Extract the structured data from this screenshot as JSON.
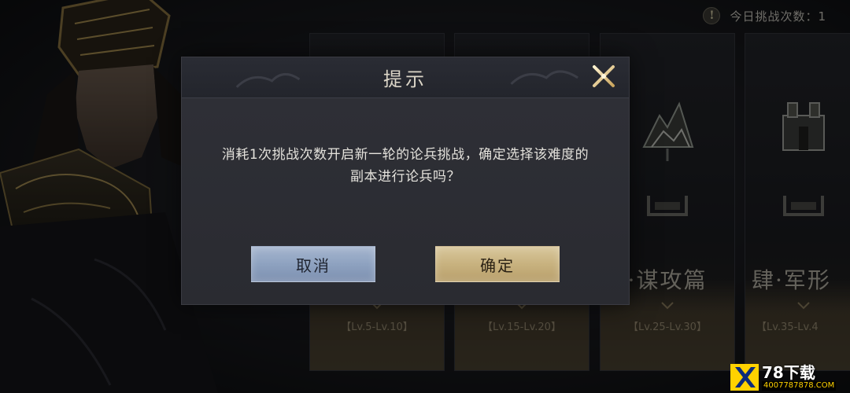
{
  "header": {
    "info_icon": "exclamation-icon",
    "challenge_count_label": "今日挑战次数：1"
  },
  "cards": [
    {
      "name": "",
      "level": "【Lv.5-Lv.10】"
    },
    {
      "name": "",
      "level": "【Lv.15-Lv.20】"
    },
    {
      "name": "·谋攻篇",
      "level": "【Lv.25-Lv.30】"
    },
    {
      "name": "肆·军形",
      "level": "【Lv.35-Lv.4"
    }
  ],
  "dialog": {
    "title": "提示",
    "close_icon": "close-x-icon",
    "message_line1": "消耗1次挑战次数开启新一轮的论兵挑战，确定选择该难度的",
    "message_line2": "副本进行论兵吗？",
    "cancel_label": "取消",
    "confirm_label": "确定"
  },
  "watermark": {
    "brand": "78下载",
    "url": "4007787878.COM"
  },
  "colors": {
    "cancel_button": "#8ea2c0",
    "confirm_button": "#c8b27f",
    "dialog_bg": "#2b2c33",
    "gold_accent": "#d8c79c"
  }
}
